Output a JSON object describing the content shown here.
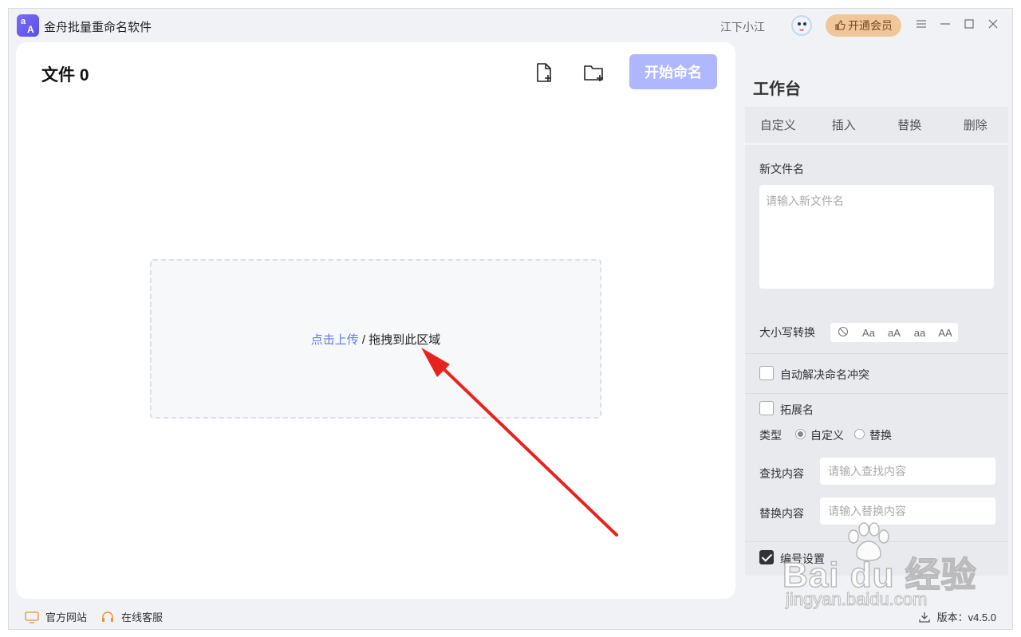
{
  "app": {
    "title": "金舟批量重命名软件",
    "icon_letters": [
      "a",
      "A"
    ]
  },
  "titlebar": {
    "username": "江下小江",
    "vip_label": "开通会员"
  },
  "main": {
    "file_count_label": "文件 0",
    "start_button": "开始命名",
    "dropzone": {
      "upload_link": "点击上传",
      "separator": " / ",
      "drag_text": "拖拽到此区域"
    }
  },
  "workbench": {
    "title": "工作台",
    "tabs": [
      "自定义",
      "插入",
      "替换",
      "删除"
    ],
    "new_name_label": "新文件名",
    "new_name_placeholder": "请输入新文件名",
    "case_label": "大小写转换",
    "case_options": [
      "⃠",
      "Aa",
      "aA",
      "aa",
      "AA"
    ],
    "auto_resolve_label": "自动解决命名冲突",
    "auto_resolve_checked": false,
    "extension_label": "拓展名",
    "extension_checked": false,
    "type_label": "类型",
    "type_options": [
      "自定义",
      "替换"
    ],
    "type_selected": "自定义",
    "find_label": "查找内容",
    "find_placeholder": "请输入查找内容",
    "replace_label": "替换内容",
    "replace_placeholder": "请输入替换内容",
    "numbering_label": "编号设置",
    "numbering_checked": true
  },
  "footer": {
    "website": "官方网站",
    "support": "在线客服",
    "version": "版本：v4.5.0"
  },
  "watermark": {
    "brand": "Bai du 经验",
    "url": "jingyan.baidu.com"
  },
  "colors": {
    "accent": "#5b7be9",
    "start_button_bg": "#aeb7ff",
    "vip_bg": "#f0c79a",
    "arrow": "#e8231f"
  }
}
